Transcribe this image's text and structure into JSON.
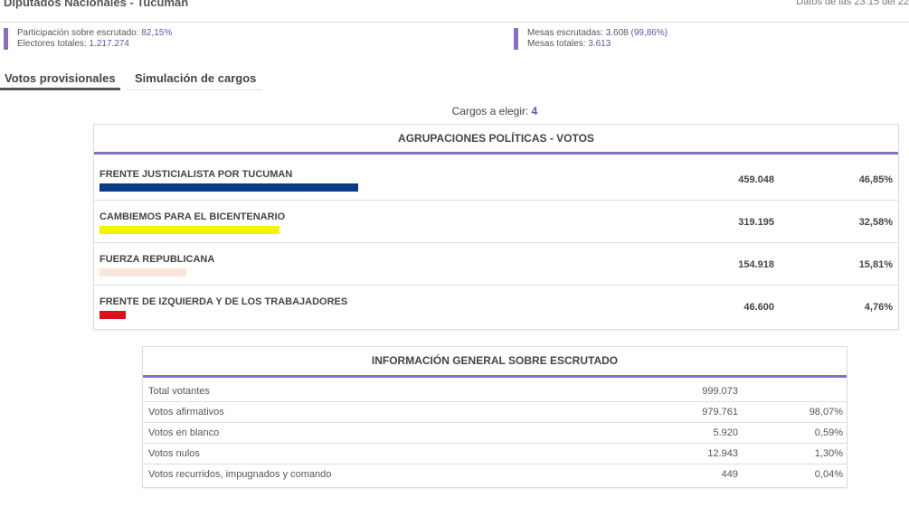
{
  "header": {
    "title": "Diputados Nacionales - Tucumán",
    "updated": "Datos de las 23:15 del 22"
  },
  "stats": {
    "participacion_label": "Participación sobre escrutado: ",
    "participacion_value": "82,15%",
    "electores_label": "Electores totales: ",
    "electores_value": "1.217.274",
    "mesas_escrutadas_label": "Mesas escrutadas: 3.608 ",
    "mesas_escrutadas_value": "(99,86%)",
    "mesas_totales_label": "Mesas totales: ",
    "mesas_totales_value": "3.613",
    "accent": "#8a6fbf"
  },
  "tabs": [
    {
      "label": "Votos provisionales",
      "active": true
    },
    {
      "label": "Simulación de cargos",
      "active": false
    }
  ],
  "cargos": {
    "label": "Cargos a elegir: ",
    "value": "4"
  },
  "votes_panel": {
    "title": "AGRUPACIONES POLÍTICAS - VOTOS",
    "rows": [
      {
        "name": "FRENTE JUSTICIALISTA POR TUCUMAN",
        "votes": "459.048",
        "pct": "46,85%",
        "share": 46.85,
        "color": "#0b3a86"
      },
      {
        "name": "CAMBIEMOS PARA EL BICENTENARIO",
        "votes": "319.195",
        "pct": "32,58%",
        "share": 32.58,
        "color": "#f4f400"
      },
      {
        "name": "FUERZA REPUBLICANA",
        "votes": "154.918",
        "pct": "15,81%",
        "share": 15.81,
        "color": "#fbe6dc"
      },
      {
        "name": "FRENTE DE IZQUIERDA Y DE LOS TRABAJADORES",
        "votes": "46.600",
        "pct": "4,76%",
        "share": 4.76,
        "color": "#d9101c"
      }
    ]
  },
  "info_panel": {
    "title": "INFORMACIÓN GENERAL SOBRE ESCRUTADO",
    "rows": [
      {
        "label": "Total votantes",
        "value": "999.073",
        "pct": ""
      },
      {
        "label": "Votos afirmativos",
        "value": "979.761",
        "pct": "98,07%"
      },
      {
        "label": "Votos en blanco",
        "value": "5.920",
        "pct": "0,59%"
      },
      {
        "label": "Votos nulos",
        "value": "12.943",
        "pct": "1,30%"
      },
      {
        "label": "Votos recurridos, impugnados y comando",
        "value": "449",
        "pct": "0,04%"
      }
    ]
  }
}
